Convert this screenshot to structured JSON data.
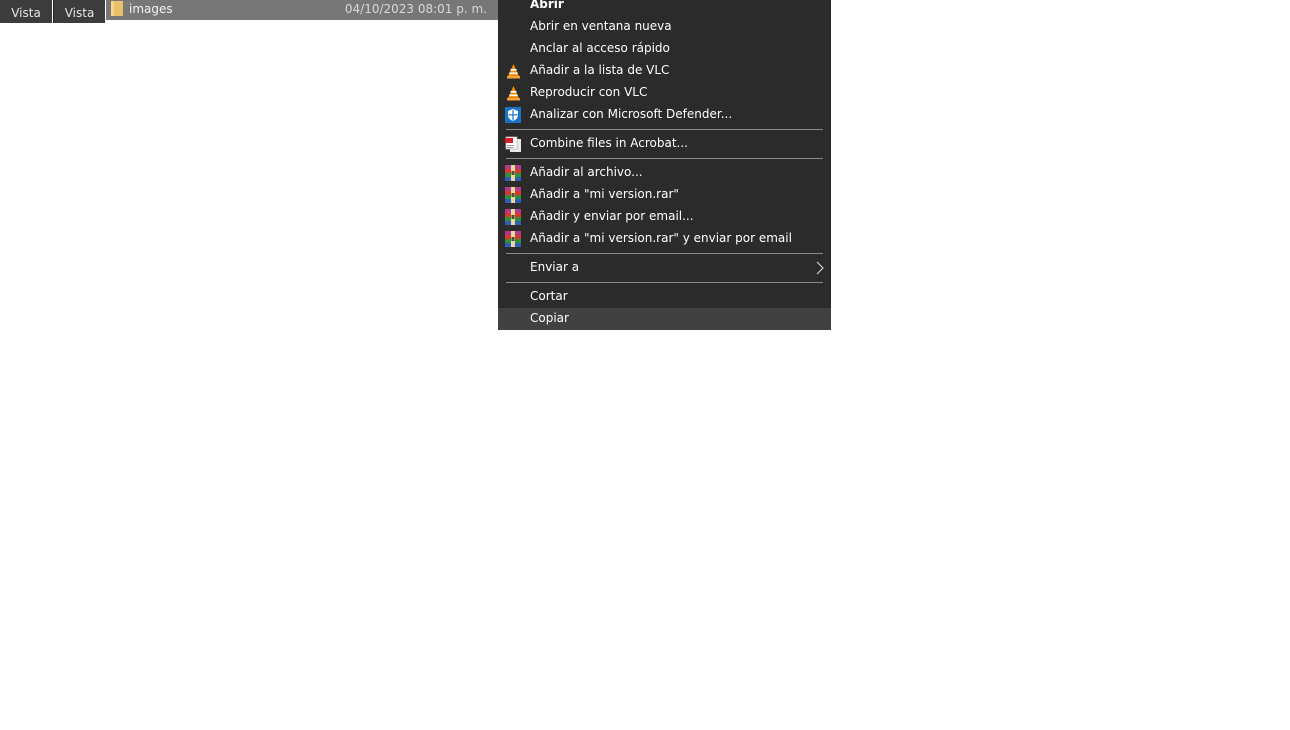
{
  "tabs": [
    {
      "label": "Vista"
    },
    {
      "label": "Vista"
    }
  ],
  "file": {
    "name": "images",
    "date": "04/10/2023 08:01 p. m.",
    "icon": "folder-icon"
  },
  "menu": {
    "items": [
      {
        "label": "Abrir",
        "icon": "",
        "bold": true
      },
      {
        "label": "Abrir en ventana nueva",
        "icon": ""
      },
      {
        "label": "Anclar al acceso rápido",
        "icon": ""
      },
      {
        "label": "Añadir a la lista de VLC",
        "icon": "vlc-icon"
      },
      {
        "label": "Reproducir con VLC",
        "icon": "vlc-icon"
      },
      {
        "label": "Analizar con Microsoft Defender...",
        "icon": "defender-shield-icon"
      },
      {
        "label": "Combine files in Acrobat...",
        "icon": "acrobat-icon"
      },
      {
        "label": "Añadir al archivo...",
        "icon": "winrar-icon"
      },
      {
        "label": "Añadir a \"mi version.rar\"",
        "icon": "winrar-icon"
      },
      {
        "label": "Añadir y enviar por email...",
        "icon": "winrar-icon"
      },
      {
        "label": "Añadir a \"mi version.rar\" y enviar por email",
        "icon": "winrar-icon"
      },
      {
        "label": "Enviar a",
        "icon": "",
        "submenu": true
      },
      {
        "label": "Cortar",
        "icon": ""
      },
      {
        "label": "Copiar",
        "icon": "",
        "highlighted": true
      }
    ]
  },
  "colors": {
    "menu_bg": "#2b2b2b",
    "highlight": "#414141",
    "separator": "#8a8a8a",
    "file_row_bg": "#777777"
  }
}
